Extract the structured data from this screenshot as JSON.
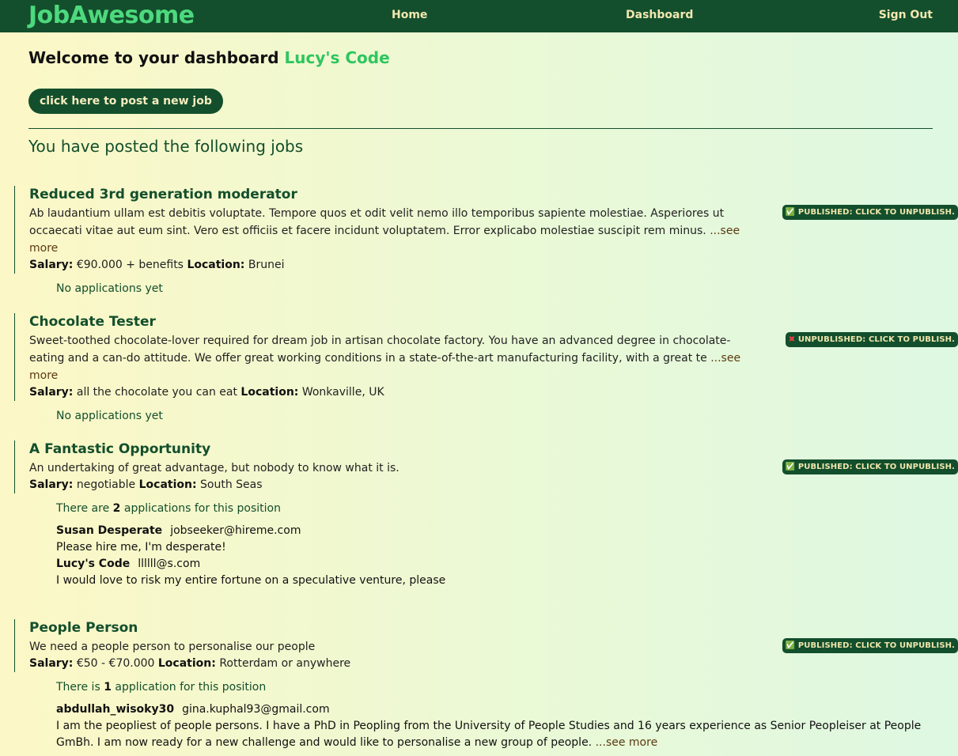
{
  "nav": {
    "brand": "JobAwesome",
    "home": "Home",
    "dashboard": "Dashboard",
    "signout": "Sign Out"
  },
  "welcome": {
    "prefix": "Welcome to your dashboard",
    "user": "Lucy's Code"
  },
  "post_button": "click here to post a new job",
  "section_title": "You have posted the following jobs",
  "labels": {
    "salary": "Salary:",
    "location": "Location:",
    "see_more": "...see more"
  },
  "jobs": [
    {
      "title": "Reduced 3rd generation moderator",
      "description": "Ab laudantium ullam est debitis voluptate. Tempore quos et odit velit nemo illo temporibus sapiente molestiae. Asperiores ut occaecati vitae aut eum sint. Vero est officiis et facere incidunt voluptatem. Error explicabo molestiae suscipit rem minus.",
      "salary": "€90.000 + benefits",
      "location": "Brunei",
      "status_icon": "✅",
      "status": "PUBLISHED: CLICK TO UNPUBLISH.",
      "apps_text": "No applications yet"
    },
    {
      "title": "Chocolate Tester",
      "description": "Sweet-toothed chocolate-lover required for dream job in artisan chocolate factory. You have an advanced degree in chocolate-eating and a can-do attitude. We offer great working conditions in a state-of-the-art manufacturing facility, with a great te",
      "salary": "all the chocolate you can eat",
      "location": "Wonkaville, UK",
      "status_icon": "✖",
      "status": "UNPUBLISHED: CLICK TO PUBLISH.",
      "apps_text": "No applications yet"
    },
    {
      "title": "A Fantastic Opportunity",
      "description": "An undertaking of great advantage, but nobody to know what it is.",
      "salary": "negotiable",
      "location": "South Seas",
      "status_icon": "✅",
      "status": "PUBLISHED: CLICK TO UNPUBLISH.",
      "apps_pre": "There are",
      "apps_count": "2",
      "apps_post": "applications for this position",
      "applications": [
        {
          "name": "Susan Desperate",
          "email": "jobseeker@hireme.com",
          "message": "Please hire me, I'm desperate!"
        },
        {
          "name": "Lucy's Code",
          "email": "llllll@s.com",
          "message": "I would love to risk my entire fortune on a speculative venture, please"
        }
      ]
    },
    {
      "title": "People Person",
      "description": "We need a people person to personalise our people",
      "salary": "€50 - €70.000",
      "location": "Rotterdam or anywhere",
      "status_icon": "✅",
      "status": "PUBLISHED: CLICK TO UNPUBLISH.",
      "apps_pre": "There is",
      "apps_count": "1",
      "apps_post": "application for this position",
      "applications": [
        {
          "name": "abdullah_wisoky30",
          "email": "gina.kuphal93@gmail.com",
          "message": "I am the peopliest of people persons. I have a PhD in Peopling from the University of People Studies and 16 years experience as Senior Peopleiser at People GmBh. I am now ready for a new challenge and would like to personalise a new group of people."
        }
      ]
    }
  ]
}
